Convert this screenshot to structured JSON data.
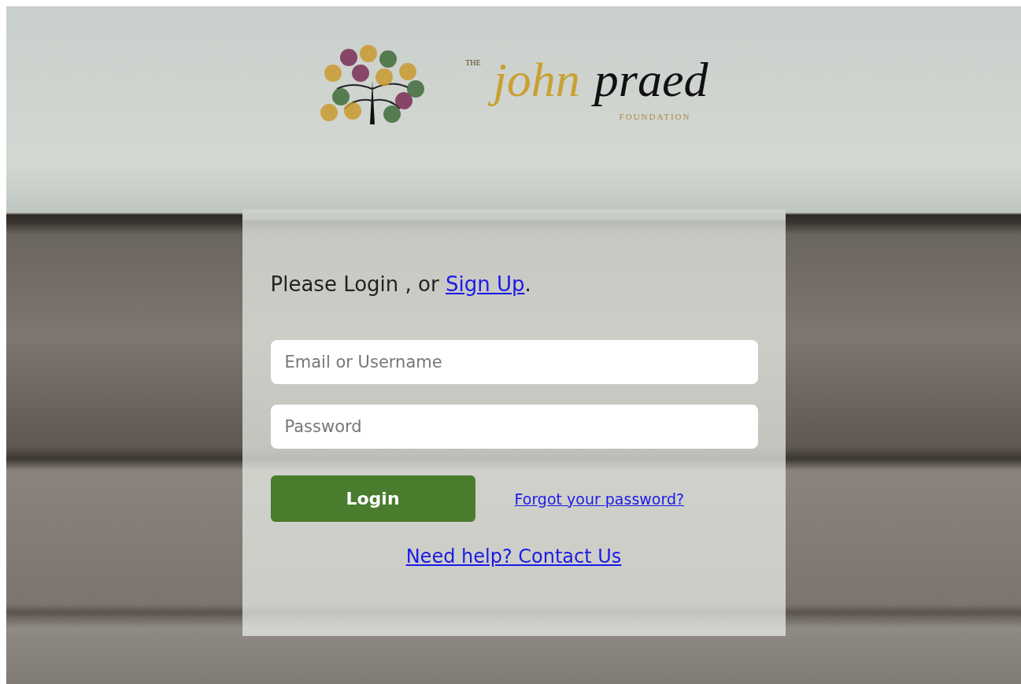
{
  "logo": {
    "prefix": "THE",
    "first": "john",
    "second": "praed",
    "sub": "FOUNDATION"
  },
  "login": {
    "prompt": "Please Login , or ",
    "signup": "Sign Up",
    "prompt_end": ".",
    "email": {
      "placeholder": "Email or Username"
    },
    "password": {
      "placeholder": "Password"
    },
    "button": "Login",
    "forgot": "Forgot your password?",
    "help": "Need help? Contact Us"
  }
}
